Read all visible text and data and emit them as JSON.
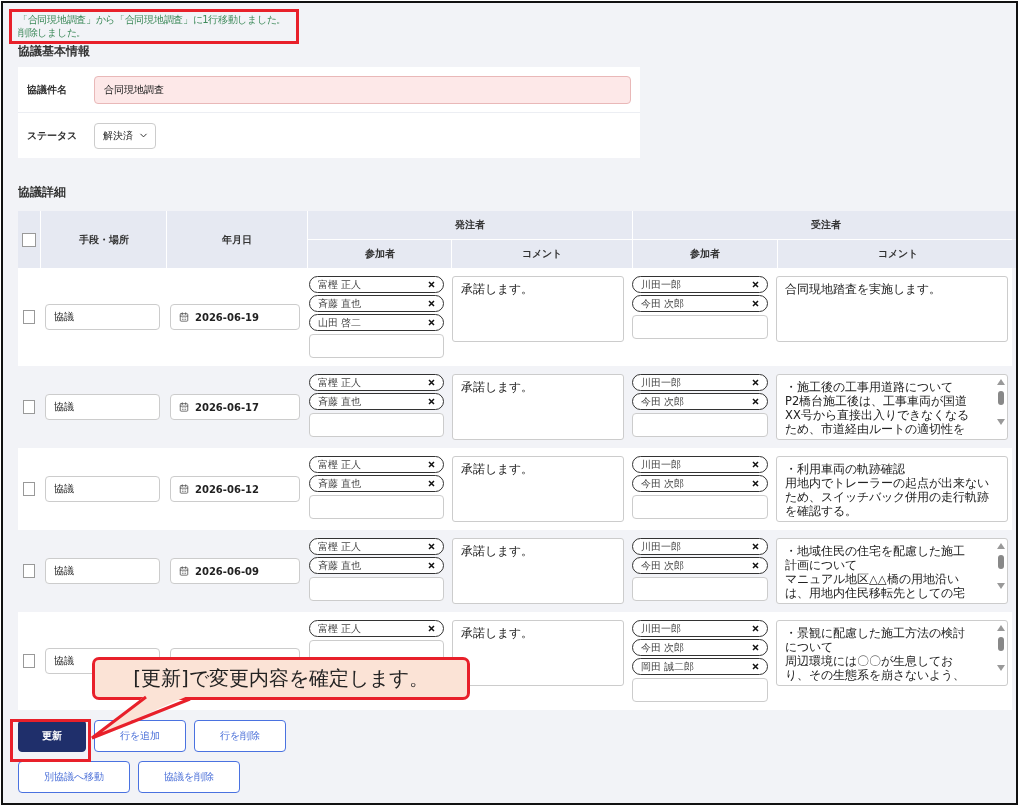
{
  "messages": [
    "「合同現地調査」から「合同現地調査」に1行移動しました。",
    "削除しました。"
  ],
  "basic_info": {
    "heading": "協議基本情報",
    "fields": [
      {
        "kind": "text",
        "label": "協議件名",
        "value": "合同現地調査",
        "invalid": true
      },
      {
        "kind": "select",
        "label": "ステータス",
        "value": "解決済"
      }
    ]
  },
  "details": {
    "heading": "協議詳細",
    "all_checked": false,
    "headers": {
      "method": "手段・場所",
      "date": "年月日",
      "groups": [
        {
          "name": "発注者",
          "participants": "参加者",
          "comment": "コメント"
        },
        {
          "name": "受注者",
          "participants": "参加者",
          "comment": "コメント"
        }
      ]
    },
    "rows": [
      {
        "checked": false,
        "method": "協議",
        "date": "2026-06-19",
        "sides": [
          {
            "participants": [
              "富樫 正人",
              "斉藤 直也",
              "山田 啓二"
            ],
            "comment": [
              "承諾します。"
            ],
            "scrollbar": false
          },
          {
            "participants": [
              "川田一郎",
              "今田 次郎"
            ],
            "comment": [
              "合同現地踏査を実施します。"
            ],
            "scrollbar": false
          }
        ]
      },
      {
        "checked": false,
        "method": "協議",
        "date": "2026-06-17",
        "sides": [
          {
            "participants": [
              "富樫 正人",
              "斉藤 直也"
            ],
            "comment": [
              "承諾します。"
            ],
            "scrollbar": false
          },
          {
            "participants": [
              "川田一郎",
              "今田 次郎"
            ],
            "comment": [
              "・施工後の工事用道路について",
              "P2橋台施工後は、工事車両が国道",
              "XX号から直接出入りできなくなる",
              "ため、市道経由ルートの適切性を"
            ],
            "scrollbar": true
          }
        ]
      },
      {
        "checked": false,
        "method": "協議",
        "date": "2026-06-12",
        "sides": [
          {
            "participants": [
              "富樫 正人",
              "斉藤 直也"
            ],
            "comment": [
              "承諾します。"
            ],
            "scrollbar": false
          },
          {
            "participants": [
              "川田一郎",
              "今田 次郎"
            ],
            "comment": [
              "・利用車両の軌跡確認",
              "用地内でトレーラーの起点が出来ない",
              "ため、スイッチバック併用の走行軌跡",
              "を確認する。"
            ],
            "scrollbar": false
          }
        ]
      },
      {
        "checked": false,
        "method": "協議",
        "date": "2026-06-09",
        "sides": [
          {
            "participants": [
              "富樫 正人",
              "斉藤 直也"
            ],
            "comment": [
              "承諾します。"
            ],
            "scrollbar": false
          },
          {
            "participants": [
              "川田一郎",
              "今田 次郎"
            ],
            "comment": [
              "・地域住民の住宅を配慮した施工",
              "計画について",
              "マニュアル地区△△橋の用地沿い",
              "は、用地内住民移転先としての宅"
            ],
            "scrollbar": true
          }
        ]
      },
      {
        "checked": false,
        "method": "協議",
        "sides": [
          {
            "participants": [
              "富樫 正人"
            ],
            "comment": [
              "承諾します。"
            ],
            "scrollbar": false
          },
          {
            "participants": [
              "川田一郎",
              "今田 次郎",
              "岡田 誠二郎"
            ],
            "comment": [
              "・景観に配慮した施工方法の検討",
              "について",
              "周辺環境には〇〇が生息してお",
              "り、その生態系を崩さないよう、"
            ],
            "scrollbar": true
          }
        ]
      }
    ]
  },
  "button_rows": [
    [
      {
        "label": "更新",
        "kind": "primary"
      },
      {
        "label": "行を追加",
        "kind": "outline"
      },
      {
        "label": "行を削除",
        "kind": "outline"
      }
    ],
    [
      {
        "label": "別協議へ移動",
        "kind": "outline"
      },
      {
        "label": "協議を削除",
        "kind": "outline"
      }
    ]
  ],
  "callout": "[更新]で変更内容を確定します。"
}
